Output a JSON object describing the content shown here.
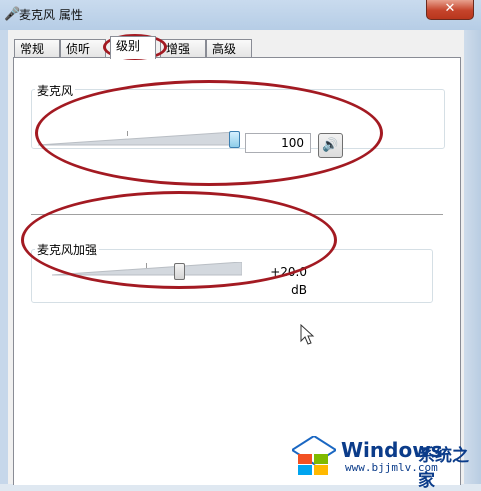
{
  "window": {
    "title": "麦克风 属性",
    "close_label": "✕"
  },
  "tabs": [
    {
      "label": "常规",
      "active": false
    },
    {
      "label": "侦听",
      "active": false
    },
    {
      "label": "级别",
      "active": true
    },
    {
      "label": "增强",
      "active": false
    },
    {
      "label": "高级",
      "active": false
    }
  ],
  "microphone": {
    "label": "麦克风",
    "value": "100",
    "level_fraction": 1.0
  },
  "boost": {
    "label": "麦克风加强",
    "value": "+20.0 dB",
    "level_fraction": 0.67
  },
  "watermark": {
    "brand": "Windows",
    "site": "系统之家",
    "url": "www.bjjmlv.com"
  },
  "colors": {
    "annotation": "#a31a22",
    "accent": "#2a5ea8"
  },
  "icons": [
    "mic-window-icon",
    "speaker-icon",
    "close-icon",
    "mouse-pointer-icon",
    "windows-logo-icon"
  ]
}
